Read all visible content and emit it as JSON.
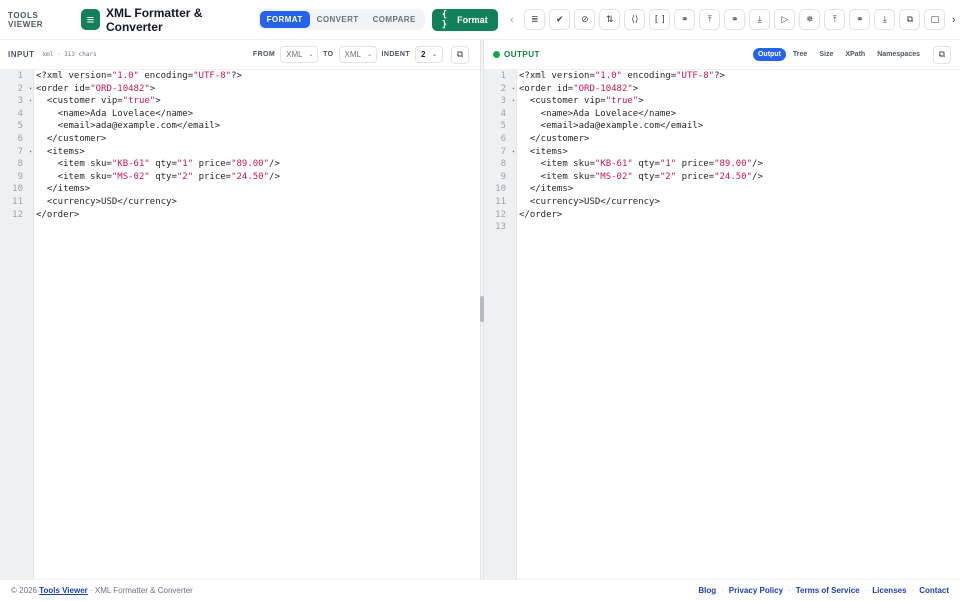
{
  "header": {
    "brand": "TOOLS VIEWER",
    "app_icon": "xml-formatter-icon",
    "app_title": "XML Formatter & Converter",
    "modes": [
      {
        "label": "FORMAT",
        "active": true
      },
      {
        "label": "CONVERT",
        "active": false
      },
      {
        "label": "COMPARE",
        "active": false
      }
    ],
    "format_button": {
      "glyph": "{ }",
      "label": "Format"
    },
    "tools": [
      "filter-icon",
      "check-circle-icon",
      "ban-icon",
      "sort-icon",
      "code-icon",
      "brackets-icon",
      "link-icon",
      "upload-icon",
      "link-icon",
      "download-icon",
      "run-icon",
      "sparkle-icon",
      "upload-icon",
      "link-icon",
      "download-icon",
      "copy-icon",
      "clipboard-icon"
    ]
  },
  "input": {
    "title": "INPUT",
    "meta": "xml · 313 chars",
    "from_label": "FROM",
    "from_value": "XML",
    "to_label": "TO",
    "to_value": "XML",
    "indent_label": "INDENT",
    "indent_value": "2",
    "line_numbers": [
      "1",
      "2",
      "3",
      "4",
      "5",
      "6",
      "7",
      "8",
      "9",
      "10",
      "11",
      "12"
    ],
    "fold_lines": [
      2,
      3,
      7
    ]
  },
  "output": {
    "title": "OUTPUT",
    "status_color": "#16a34a",
    "tabs": [
      {
        "label": "Output",
        "active": true
      },
      {
        "label": "Tree",
        "active": false
      },
      {
        "label": "Size",
        "active": false
      },
      {
        "label": "XPath",
        "active": false
      },
      {
        "label": "Namespaces",
        "active": false
      }
    ],
    "line_numbers": [
      "1",
      "2",
      "3",
      "4",
      "5",
      "6",
      "7",
      "8",
      "9",
      "10",
      "11",
      "12",
      "13"
    ],
    "fold_lines": [
      2,
      3,
      7
    ]
  },
  "code": {
    "lines": [
      [
        {
          "t": "<?xml version="
        },
        {
          "t": "\"1.0\"",
          "s": 1
        },
        {
          "t": " encoding="
        },
        {
          "t": "\"UTF-8\"",
          "s": 1
        },
        {
          "t": "?>"
        }
      ],
      [
        {
          "t": "<order id="
        },
        {
          "t": "\"ORD-10482\"",
          "s": 1
        },
        {
          "t": ">"
        }
      ],
      [
        {
          "t": "  <customer vip="
        },
        {
          "t": "\"true\"",
          "s": 1
        },
        {
          "t": ">"
        }
      ],
      [
        {
          "t": "    <name>Ada Lovelace</name>"
        }
      ],
      [
        {
          "t": "    <email>ada@example.com</email>"
        }
      ],
      [
        {
          "t": "  </customer>"
        }
      ],
      [
        {
          "t": "  <items>"
        }
      ],
      [
        {
          "t": "    <item sku="
        },
        {
          "t": "\"KB-61\"",
          "s": 1
        },
        {
          "t": " qty="
        },
        {
          "t": "\"1\"",
          "s": 1
        },
        {
          "t": " price="
        },
        {
          "t": "\"89.00\"",
          "s": 1
        },
        {
          "t": "/>"
        }
      ],
      [
        {
          "t": "    <item sku="
        },
        {
          "t": "\"MS-02\"",
          "s": 1
        },
        {
          "t": " qty="
        },
        {
          "t": "\"2\"",
          "s": 1
        },
        {
          "t": " price="
        },
        {
          "t": "\"24.50\"",
          "s": 1
        },
        {
          "t": "/>"
        }
      ],
      [
        {
          "t": "  </items>"
        }
      ],
      [
        {
          "t": "  <currency>USD</currency>"
        }
      ],
      [
        {
          "t": "</order>"
        }
      ]
    ]
  },
  "footer": {
    "copyright": "© 2026",
    "site_link": "Tools Viewer",
    "suffix": "· XML Formatter & Converter",
    "links": [
      "Blog",
      "Privacy Policy",
      "Terms of Service",
      "Licenses",
      "Contact"
    ]
  },
  "colors": {
    "accent_green": "#13805b",
    "accent_blue": "#2563eb",
    "string_pink": "#c2185b"
  }
}
